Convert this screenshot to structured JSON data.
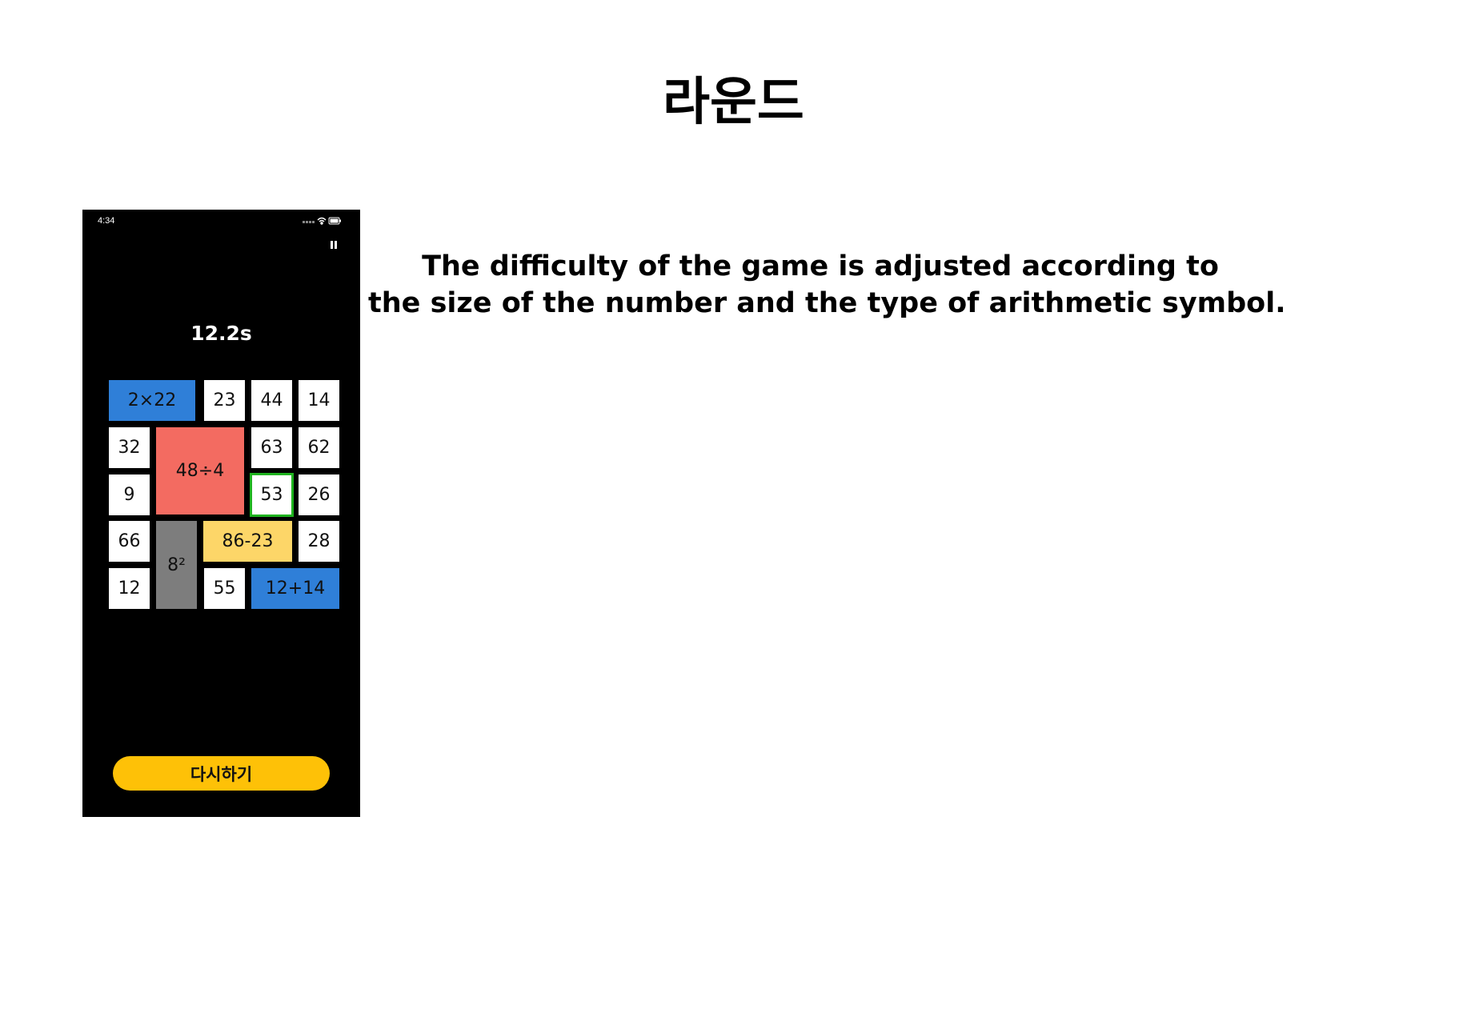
{
  "page": {
    "title": "라운드",
    "description_lines": [
      "The difficulty of the game is adjusted according to",
      "the size of the number and the type of arithmetic symbol."
    ]
  },
  "phone": {
    "status_time": "4:34",
    "status_icons": [
      "signal-icon",
      "wifi-icon",
      "battery-icon"
    ],
    "timer": "12.2s",
    "retry_label": "다시하기",
    "colors": {
      "background": "#000000",
      "tile_white": "#ffffff",
      "tile_blue": "#2f7fd8",
      "tile_red": "#f36b61",
      "tile_gray": "#7d7d7d",
      "tile_yellow": "#fdd668",
      "tile_selected_border": "#1fb31f",
      "retry_button": "#fec107"
    },
    "tiles": [
      {
        "label": "2×22",
        "color": "blue"
      },
      {
        "label": "23",
        "color": "white"
      },
      {
        "label": "44",
        "color": "white"
      },
      {
        "label": "14",
        "color": "white"
      },
      {
        "label": "32",
        "color": "white"
      },
      {
        "label": "48÷4",
        "color": "red"
      },
      {
        "label": "63",
        "color": "white"
      },
      {
        "label": "62",
        "color": "white"
      },
      {
        "label": "9",
        "color": "white"
      },
      {
        "label": "53",
        "color": "white",
        "selected": true
      },
      {
        "label": "26",
        "color": "white"
      },
      {
        "label": "66",
        "color": "white"
      },
      {
        "label": "8²",
        "color": "gray"
      },
      {
        "label": "86-23",
        "color": "yellow"
      },
      {
        "label": "28",
        "color": "white"
      },
      {
        "label": "12",
        "color": "white"
      },
      {
        "label": "55",
        "color": "white"
      },
      {
        "label": "12+14",
        "color": "blue"
      }
    ]
  }
}
